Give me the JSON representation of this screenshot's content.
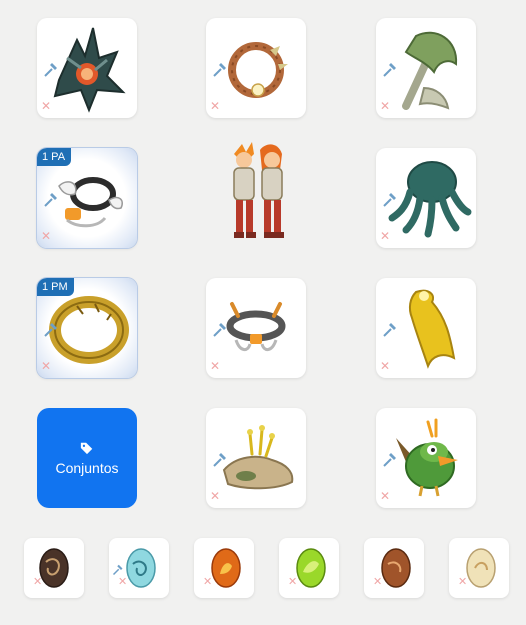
{
  "slots": {
    "amulet": {
      "remove": "✕"
    },
    "ring_left": {
      "remove": "✕"
    },
    "weapon": {
      "remove": "✕"
    },
    "ring_bonus": {
      "badge": "1 PA",
      "remove": "✕"
    },
    "hat": {
      "remove": "✕"
    },
    "ring_bonus_2": {
      "badge": "1 PM",
      "remove": "✕"
    },
    "belt": {
      "remove": "✕"
    },
    "cape": {
      "remove": "✕"
    },
    "shield": {
      "remove": "✕"
    },
    "pet": {
      "remove": "✕"
    }
  },
  "sets_button": {
    "label": "Conjuntos",
    "icon": "tag-icon"
  },
  "dofus_row": [
    {
      "name": "dofus-egg-1",
      "remove": "✕"
    },
    {
      "name": "dofus-egg-2",
      "remove": "✕"
    },
    {
      "name": "dofus-egg-3",
      "remove": "✕"
    },
    {
      "name": "dofus-egg-4",
      "remove": "✕"
    },
    {
      "name": "dofus-egg-5",
      "remove": "✕"
    },
    {
      "name": "dofus-egg-6",
      "remove": "✕"
    }
  ],
  "colors": {
    "accent": "#1174f0",
    "badge": "#1f6fb5",
    "remove": "#f0a6a6",
    "background": "#f1f1f0"
  }
}
